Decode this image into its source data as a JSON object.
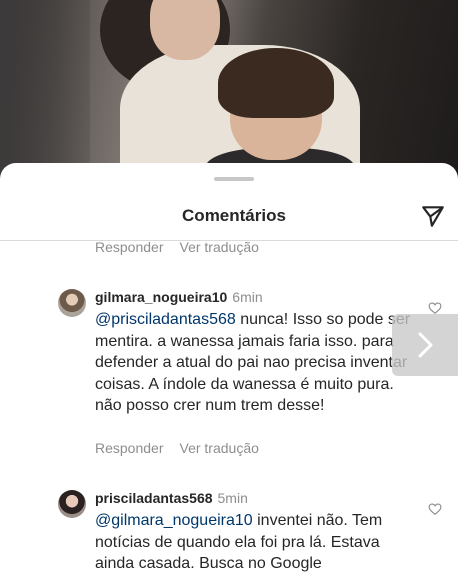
{
  "header": {
    "title": "Comentários"
  },
  "actions": {
    "reply": "Responder",
    "translate": "Ver tradução"
  },
  "comments": [
    {
      "username": "gilmara_nogueira10",
      "time": "6min",
      "mention": "@priscila",
      "mention_rest": "dantas568",
      "text": " nunca! Isso so pode ser mentira. a wanessa jamais faria isso. para defender a atual do pai nao precisa inventar coisas. A índole da wanessa é muito pura. não posso crer num trem desse!"
    },
    {
      "username": "prisciladantas568",
      "time": "5min",
      "mention": "@gilmara_nogueira10",
      "text": " inventei não. Tem notícias de quando ela foi pra lá. Estava ainda casada. Busca no Google"
    }
  ],
  "icons": {
    "send": "send-icon",
    "heart": "heart-icon",
    "next": "chevron-right-icon"
  }
}
